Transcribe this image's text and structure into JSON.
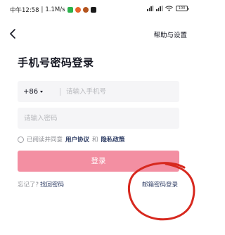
{
  "status_bar": {
    "time": "中午12:58",
    "speed": "1.1M/s",
    "battery": "100",
    "app_icon_colors": [
      "#2bb24c",
      "#e8642c",
      "#b3541e",
      "#1a1a1a"
    ]
  },
  "header": {
    "back_icon": "chevron-left-icon",
    "help_label": "帮助与设置"
  },
  "main": {
    "title": "手机号密码登录",
    "country_code": "+86",
    "phone_placeholder": "请输入手机号",
    "password_placeholder": "请输入密码",
    "agreement": {
      "prefix": "已阅读并同意",
      "user_agreement": "用户协议",
      "and": "和",
      "privacy_policy": "隐私政策"
    },
    "login_button": "登录",
    "forgot_prefix": "忘记了?",
    "retrieve_password": "找回密码",
    "email_login": "邮箱密码登录"
  },
  "colors": {
    "login_button": "#f38fa2",
    "link": "#2b3a62",
    "annotation": "#d7281e"
  }
}
